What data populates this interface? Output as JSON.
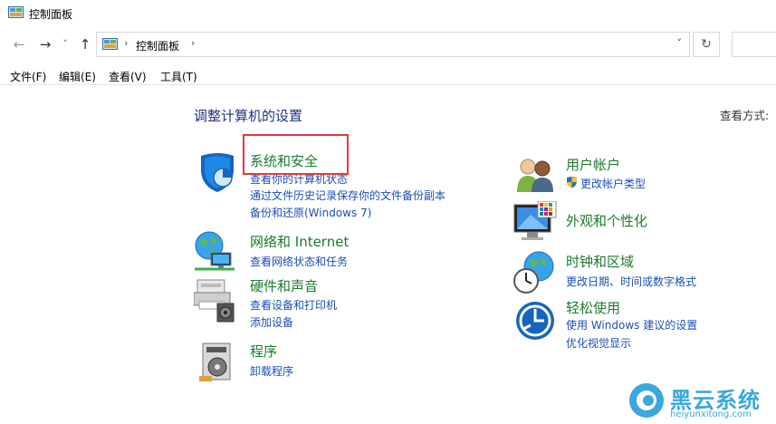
{
  "window": {
    "title": "控制面板"
  },
  "nav": {
    "back_glyph": "←",
    "forward_glyph": "→",
    "recent_glyph": "˅",
    "up_glyph": "↑",
    "refresh_glyph": "↻",
    "dropdown_glyph": "˅"
  },
  "address": {
    "crumb": "控制面板",
    "separator": "›"
  },
  "menu": [
    "文件(F)",
    "编辑(E)",
    "查看(V)",
    "工具(T)"
  ],
  "main": {
    "heading": "调整计算机的设置",
    "view_by": "查看方式:"
  },
  "categories": {
    "security": {
      "title": "系统和安全",
      "links": [
        "查看你的计算机状态",
        "通过文件历史记录保存你的文件备份副本",
        "备份和还原(Windows 7)"
      ],
      "icon": "shield-icon"
    },
    "network": {
      "title": "网络和 Internet",
      "links": [
        "查看网络状态和任务"
      ],
      "icon": "network-globe-icon"
    },
    "hardware": {
      "title": "硬件和声音",
      "links": [
        "查看设备和打印机",
        "添加设备"
      ],
      "icon": "printer-icon"
    },
    "programs": {
      "title": "程序",
      "links": [
        "卸载程序"
      ],
      "icon": "programs-icon"
    },
    "users": {
      "title": "用户帐户",
      "links": [
        "更改帐户类型"
      ],
      "icon": "users-icon"
    },
    "appearance": {
      "title": "外观和个性化",
      "links": [],
      "icon": "monitor-icon"
    },
    "clock": {
      "title": "时钟和区域",
      "links": [
        "更改日期、时间或数字格式"
      ],
      "icon": "clock-globe-icon"
    },
    "ease": {
      "title": "轻松使用",
      "links": [
        "使用 Windows 建议的设置",
        "优化视觉显示"
      ],
      "icon": "ease-of-access-icon"
    }
  },
  "watermark": {
    "name": "黑云系统",
    "url": "heiyunxitong.com"
  },
  "colors": {
    "heading": "#1e3287",
    "category_title": "#1e7a2e",
    "link": "#1a4fb5",
    "highlight": "#e23a3a"
  }
}
